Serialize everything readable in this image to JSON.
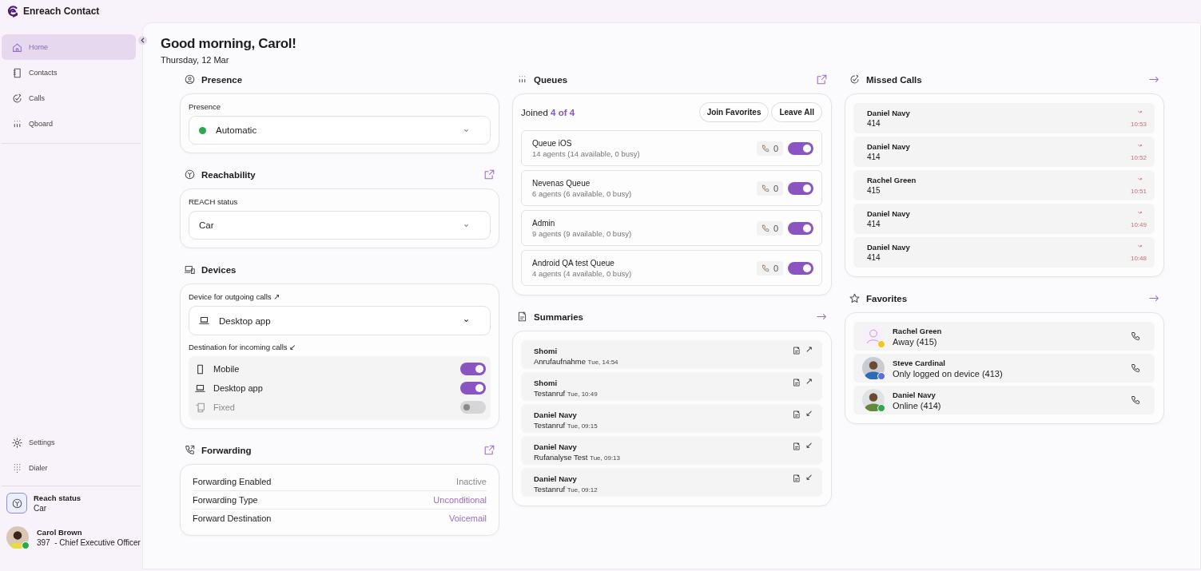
{
  "app": {
    "title": "Enreach Contact"
  },
  "sidebar": {
    "nav": [
      {
        "label": "Home",
        "selected": true
      },
      {
        "label": "Contacts",
        "selected": false
      },
      {
        "label": "Calls",
        "selected": false
      },
      {
        "label": "Qboard",
        "selected": false
      }
    ],
    "bottom_nav": [
      {
        "label": "Settings",
        "selected": false
      },
      {
        "label": "Dialer",
        "selected": false
      }
    ],
    "reach_status": {
      "label": "Reach status",
      "value": "Car"
    },
    "user": {
      "name": "Carol Brown",
      "detail": "397  - Chief Executive Officer",
      "color": "#2ea84a"
    }
  },
  "greeting": {
    "title": "Good morning, Carol!",
    "date": "Thursday, 12 Mar"
  },
  "presence": {
    "title": "Presence",
    "label": "Presence",
    "value": "Automatic",
    "color": "#2ea84a"
  },
  "reachability": {
    "title": "Reachability",
    "label": "REACH status",
    "value": "Car"
  },
  "devices": {
    "title": "Devices",
    "outgoing_label": "Device for outgoing calls ↗",
    "outgoing_value": "Desktop app",
    "incoming_label": "Destination for incoming calls ↙",
    "destinations": [
      {
        "label": "Mobile",
        "on": true,
        "disabled": false
      },
      {
        "label": "Desktop app",
        "on": true,
        "disabled": false
      },
      {
        "label": "Fixed",
        "on": false,
        "disabled": true
      }
    ]
  },
  "forwarding": {
    "title": "Forwarding",
    "rows": [
      {
        "label": "Forwarding Enabled",
        "value": "Inactive",
        "kind": "muted"
      },
      {
        "label": "Forwarding Type",
        "value": "Unconditional",
        "kind": "accent"
      },
      {
        "label": "Forward Destination",
        "value": "Voicemail",
        "kind": "accent"
      }
    ]
  },
  "queues": {
    "title": "Queues",
    "joined_label": "Joined",
    "joined_count": "4 of 4",
    "buttons": [
      "Join Favorites",
      "Leave All"
    ],
    "items": [
      {
        "name": "Queue iOS",
        "agents": "14 agents (14 available, 0 busy)",
        "calls": "0",
        "on": true
      },
      {
        "name": "Nevenas Queue",
        "agents": "6 agents (6 available, 0 busy)",
        "calls": "0",
        "on": true
      },
      {
        "name": "Admin",
        "agents": "9 agents (9 available, 0 busy)",
        "calls": "0",
        "on": true
      },
      {
        "name": "Android QA test Queue",
        "agents": "4 agents (4 available, 0 busy)",
        "calls": "0",
        "on": true
      }
    ]
  },
  "summaries": {
    "title": "Summaries",
    "items": [
      {
        "name": "Shomi",
        "subject": "Anrufaufnahme",
        "time": "Tue, 14:54",
        "direction": "↗"
      },
      {
        "name": "Shomi",
        "subject": "Testanruf",
        "time": "Tue, 10:49",
        "direction": "↗"
      },
      {
        "name": "Daniel Navy",
        "subject": "Testanruf",
        "time": "Tue, 09:15",
        "direction": "↙"
      },
      {
        "name": "Daniel Navy",
        "subject": "Rufanalyse Test",
        "time": "Tue, 09:13",
        "direction": "↙"
      },
      {
        "name": "Daniel Navy",
        "subject": "Testanruf",
        "time": "Tue, 09:12",
        "direction": "↙"
      }
    ]
  },
  "missed_calls": {
    "title": "Missed Calls",
    "items": [
      {
        "name": "Daniel Navy",
        "number": "414",
        "time": "10:53"
      },
      {
        "name": "Daniel Navy",
        "number": "414",
        "time": "10:52"
      },
      {
        "name": "Rachel Green",
        "number": "415",
        "time": "10:51"
      },
      {
        "name": "Daniel Navy",
        "number": "414",
        "time": "10:49"
      },
      {
        "name": "Daniel Navy",
        "number": "414",
        "time": "10:48"
      }
    ]
  },
  "favorites": {
    "title": "Favorites",
    "items": [
      {
        "name": "Rachel Green",
        "status": "Away (415)",
        "color": "#f5c518",
        "kind": "placeholder"
      },
      {
        "name": "Steve Cardinal",
        "status": "Only logged on device (413)",
        "color": "#5b6ee1",
        "kind": "picture"
      },
      {
        "name": "Daniel Navy",
        "status": "Online (414)",
        "color": "#2ea84a",
        "kind": "picture"
      }
    ]
  }
}
